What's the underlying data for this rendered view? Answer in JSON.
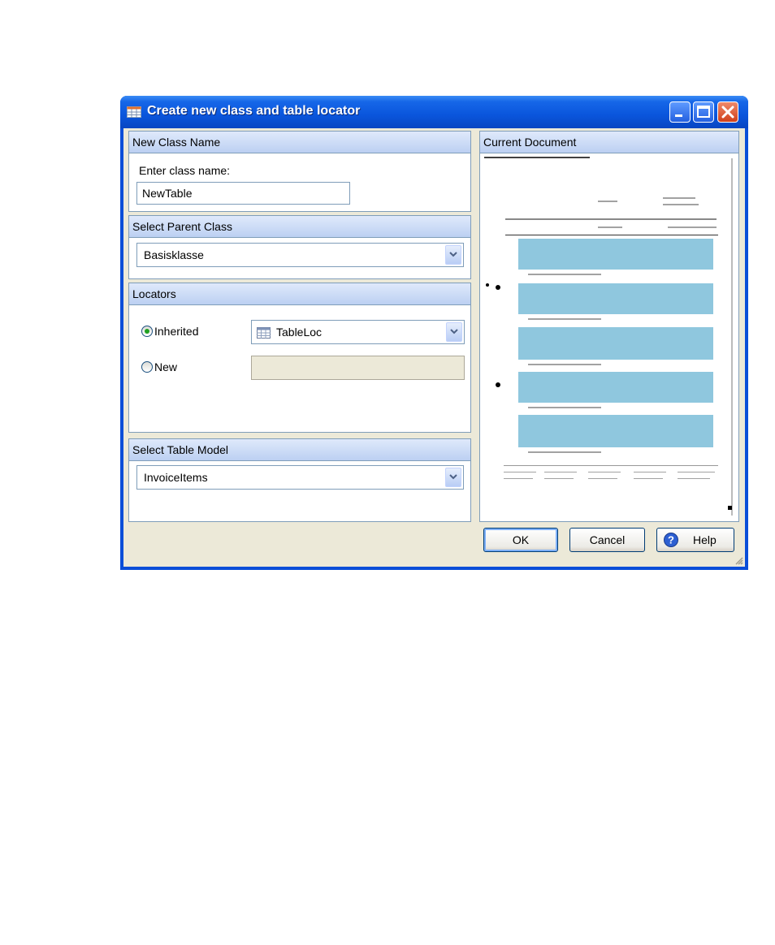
{
  "window": {
    "title": "Create new class and table locator"
  },
  "new_class": {
    "header": "New Class Name",
    "prompt": "Enter class name:",
    "value": "NewTable"
  },
  "parent_class": {
    "header": "Select Parent Class",
    "selected": "Basisklasse"
  },
  "locators": {
    "header": "Locators",
    "inherited_label": "Inherited",
    "inherited_selected": "TableLoc",
    "new_label": "New",
    "selected_option": "Inherited"
  },
  "table_model": {
    "header": "Select Table Model",
    "selected": "InvoiceItems"
  },
  "document": {
    "header": "Current Document"
  },
  "buttons": {
    "ok": "OK",
    "cancel": "Cancel",
    "help": "Help"
  },
  "colors": {
    "title_bar": "#0a55dc",
    "panel_header": "#c8d8f5",
    "doc_highlight": "#8fc7de",
    "radio_dot": "#21a121"
  },
  "icons": {
    "title": "table-icon",
    "locator": "table-icon",
    "help": "question-icon"
  }
}
